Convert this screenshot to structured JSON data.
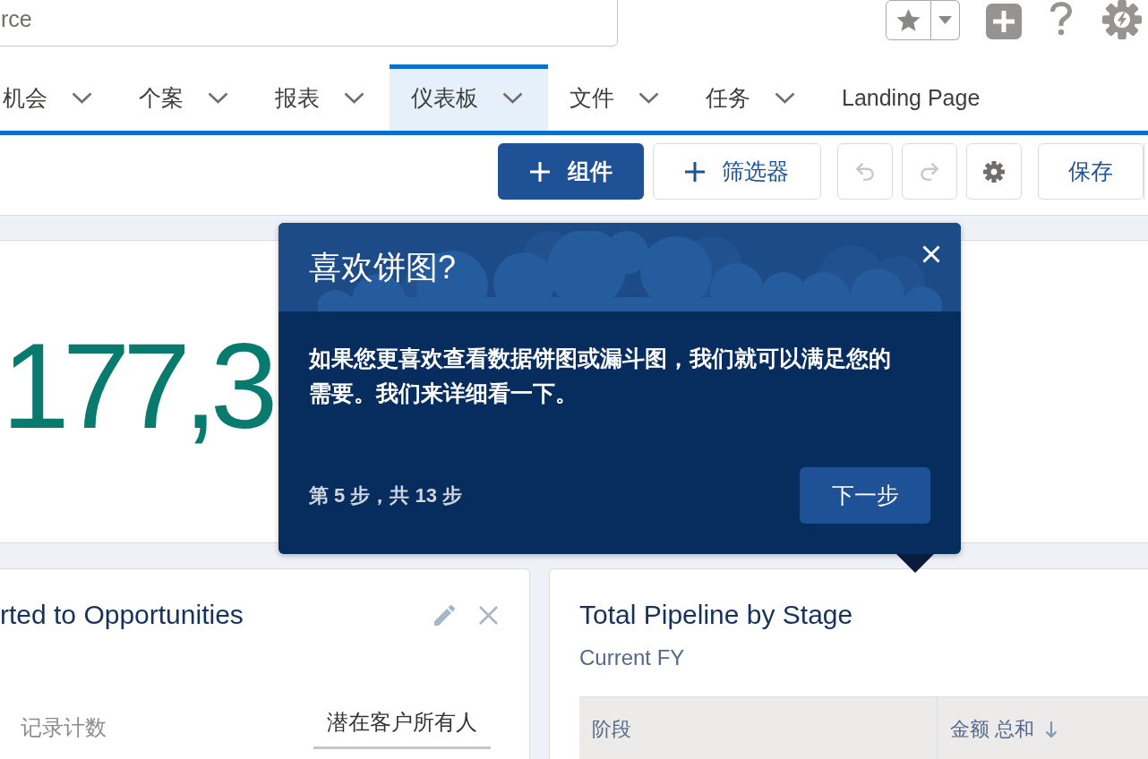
{
  "search": {
    "placeholder": "rce"
  },
  "tabs": [
    {
      "label": "机会",
      "selected": false,
      "has_menu": true
    },
    {
      "label": "个案",
      "selected": false,
      "has_menu": true
    },
    {
      "label": "报表",
      "selected": false,
      "has_menu": true
    },
    {
      "label": "仪表板",
      "selected": true,
      "has_menu": true
    },
    {
      "label": "文件",
      "selected": false,
      "has_menu": true
    },
    {
      "label": "任务",
      "selected": false,
      "has_menu": true
    },
    {
      "label": "Landing Page",
      "selected": false,
      "has_menu": false
    }
  ],
  "toolbar": [
    {
      "kind": "brand_add",
      "label": "组件"
    },
    {
      "kind": "neutral_add",
      "label": "筛选器"
    },
    {
      "kind": "undo",
      "disabled": true
    },
    {
      "kind": "redo",
      "disabled": true
    },
    {
      "kind": "settings",
      "disabled": false
    },
    {
      "kind": "neutral",
      "label": "保存"
    }
  ],
  "metric_card": {
    "value": "177,3"
  },
  "widgets": [
    {
      "kind": "chart",
      "title": "rted to Opportunities",
      "actions_visible": true,
      "measure_label": "记录计数",
      "grouping_label": "潜在客户所有人"
    },
    {
      "kind": "table",
      "title": "Total Pipeline by Stage",
      "subtitle": "Current FY",
      "actions_visible": false,
      "columns": [
        {
          "label": "阶段",
          "sorted_desc": false
        },
        {
          "label": "金额 总和",
          "sorted_desc": true
        }
      ]
    }
  ],
  "walkthrough": {
    "title": "喜欢饼图?",
    "body": "如果您更喜欢查看数据饼图或漏斗图，我们就可以满足您的需要。我们来详细看一下。",
    "step": "第 5 步，共 13 步",
    "next_button": "下一步"
  }
}
